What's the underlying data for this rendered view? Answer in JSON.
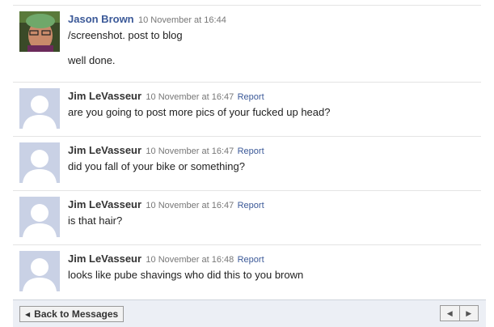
{
  "messages": [
    {
      "author": "Jason Brown",
      "time": "10 November at 16:44",
      "report": "",
      "lines": [
        "/screenshot. post to blog",
        "well done."
      ]
    },
    {
      "author": "Jim LeVasseur",
      "time": "10 November at 16:47",
      "report": "Report",
      "lines": [
        "are you going to post more pics of your fucked up head?"
      ]
    },
    {
      "author": "Jim LeVasseur",
      "time": "10 November at 16:47",
      "report": "Report",
      "lines": [
        "did you fall of your bike or something?"
      ]
    },
    {
      "author": "Jim LeVasseur",
      "time": "10 November at 16:47",
      "report": "Report",
      "lines": [
        "is that hair?"
      ]
    },
    {
      "author": "Jim LeVasseur",
      "time": "10 November at 16:48",
      "report": "Report",
      "lines": [
        "looks like pube shavings who did this to you brown"
      ]
    }
  ],
  "footer": {
    "back_label": "Back to Messages",
    "back_icon": "left-triangle-icon",
    "prev_icon": "left-triangle-icon",
    "next_icon": "right-triangle-icon"
  },
  "colors": {
    "link": "#3b5998",
    "avatar_placeholder": "#c9d1e5",
    "footer_bg": "#eceff5"
  }
}
